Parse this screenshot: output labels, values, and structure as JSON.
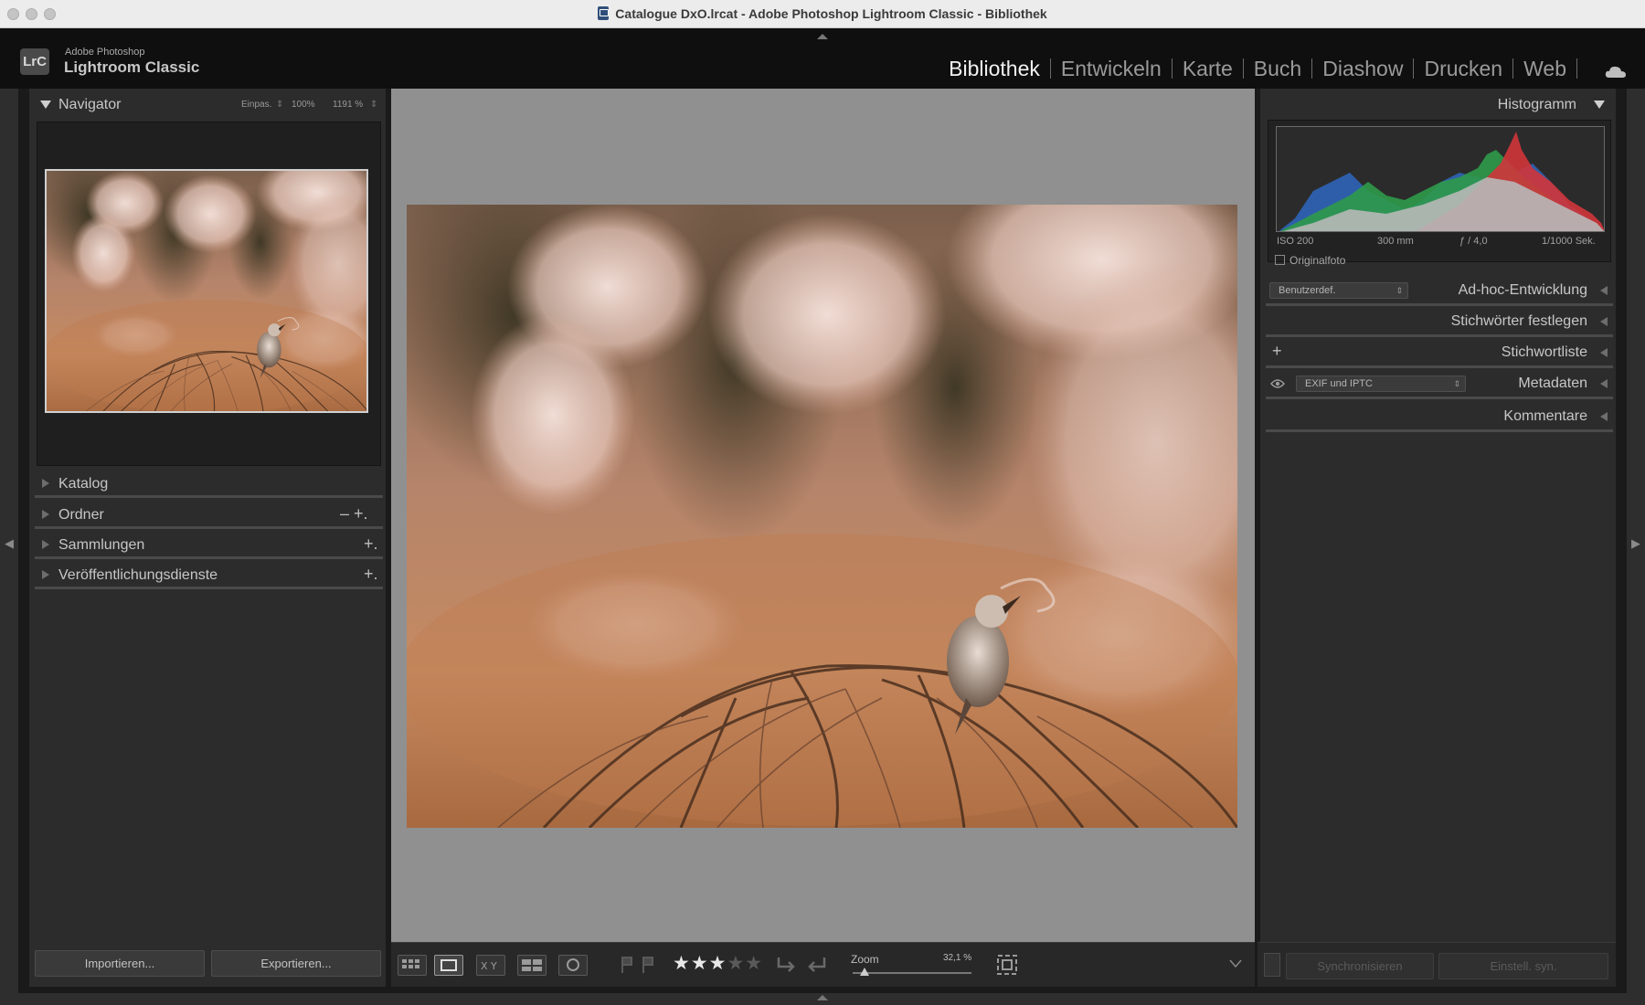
{
  "window": {
    "title": "Catalogue DxO.lrcat - Adobe Photoshop Lightroom Classic - Bibliothek"
  },
  "app": {
    "brand_small": "Adobe Photoshop",
    "brand_big": "Lightroom Classic",
    "badge": "LrC"
  },
  "modules": [
    {
      "label": "Bibliothek",
      "active": true
    },
    {
      "label": "Entwickeln"
    },
    {
      "label": "Karte"
    },
    {
      "label": "Buch"
    },
    {
      "label": "Diashow"
    },
    {
      "label": "Drucken"
    },
    {
      "label": "Web"
    }
  ],
  "navigator": {
    "title": "Navigator",
    "zoom_options": [
      "Einpas.",
      "100%",
      "1191 %"
    ]
  },
  "left_sections": [
    {
      "label": "Katalog"
    },
    {
      "label": "Ordner",
      "actions": "–  +."
    },
    {
      "label": "Sammlungen",
      "actions": "+."
    },
    {
      "label": "Veröffentlichungsdienste",
      "actions": "+."
    }
  ],
  "left_buttons": {
    "import": "Importieren...",
    "export": "Exportieren..."
  },
  "histogram": {
    "title": "Histogramm",
    "iso": "ISO 200",
    "focal": "300 mm",
    "aperture": "ƒ / 4,0",
    "shutter": "1/1000 Sek.",
    "original": "Originalfoto"
  },
  "right_sections": {
    "quick_develop": {
      "label": "Ad-hoc-Entwicklung",
      "preset": "Benutzerdef."
    },
    "keywording": {
      "label": "Stichwörter festlegen"
    },
    "keyword_list": {
      "label": "Stichwortliste",
      "add": "+"
    },
    "metadata": {
      "label": "Metadaten",
      "preset": "EXIF und IPTC"
    },
    "comments": {
      "label": "Kommentare"
    }
  },
  "toolbar": {
    "rating": 3,
    "rating_stars": {
      "on": "★★★",
      "off": "★★"
    },
    "zoom_label": "Zoom",
    "zoom_value": "32,1 %",
    "zoom_fraction": 0.1
  },
  "right_buttons": {
    "sync": "Synchronisieren",
    "sync_settings": "Einstell. syn."
  }
}
